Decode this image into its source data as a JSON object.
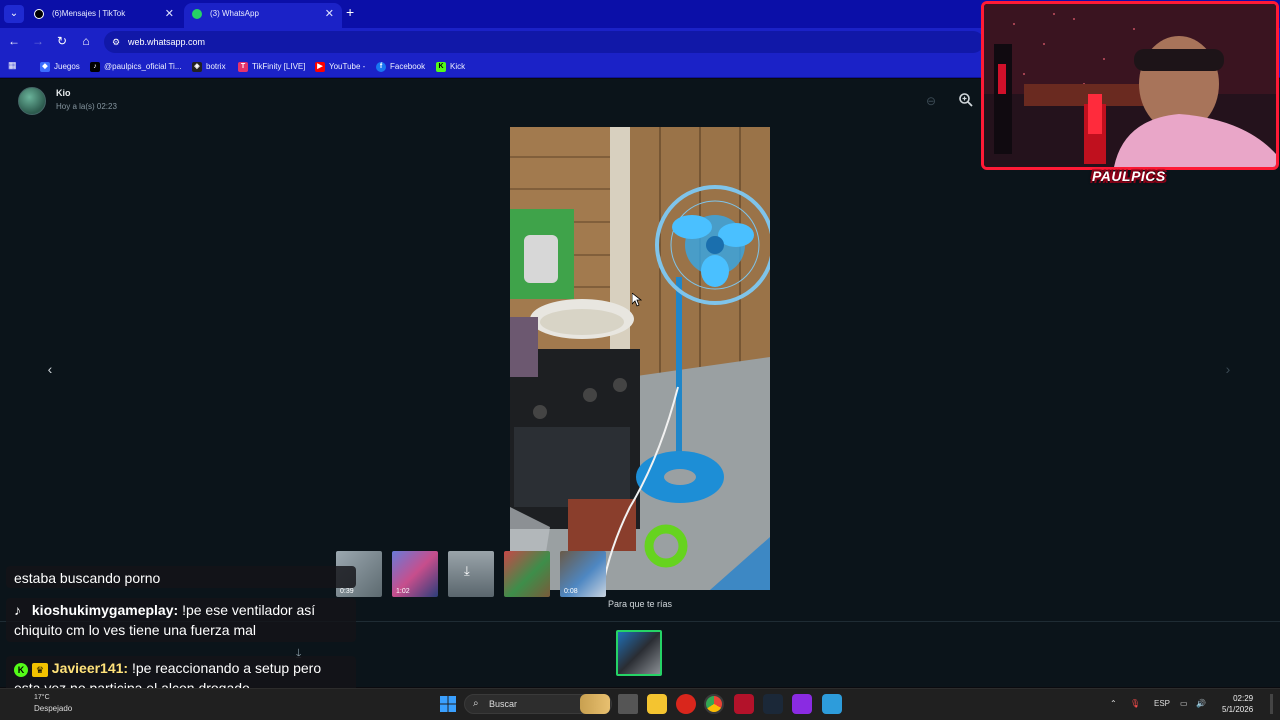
{
  "browser": {
    "tabs": [
      {
        "title": "(6)Mensajes | TikTok",
        "active": false
      },
      {
        "title": "(3) WhatsApp",
        "active": true
      }
    ],
    "url": "web.whatsapp.com",
    "bookmarks": [
      "Juegos",
      "@paulpics_oficial Ti...",
      "botrix",
      "TikFinity [LIVE]",
      "YouTube -",
      "Facebook",
      "Kick"
    ]
  },
  "viewer": {
    "sender": "Kio",
    "sent_time": "Hoy a la(s) 02:23",
    "caption": "Para que te rías",
    "thumbnails": [
      {
        "duration": "0:39"
      },
      {
        "duration": "1:02"
      },
      {
        "duration": ""
      },
      {
        "duration": ""
      },
      {
        "duration": "0:08"
      },
      {
        "duration": ""
      }
    ]
  },
  "stream_overlay": {
    "logo_text": "PAULPICS",
    "chat": [
      {
        "user": "",
        "message": "estaba buscando porno"
      },
      {
        "user": "kioshukimygameplay:",
        "message": "!pe ese ventilador así chiquito cm lo ves tiene una fuerza mal"
      },
      {
        "user": "Javieer141:",
        "message": "!pe reaccionando a setup pero esta vez no participa el alcon drogado"
      }
    ]
  },
  "taskbar": {
    "weather_temp": "17°C",
    "weather_desc": "Despejado",
    "search_placeholder": "Buscar",
    "language": "ESP",
    "time": "02:29",
    "date": "5/1/2026"
  },
  "colors": {
    "browser_frame": "#1b22c7",
    "whatsapp_bg": "#0b141a",
    "thumb_active": "#25d366",
    "webcam_border": "#ff1a36"
  }
}
